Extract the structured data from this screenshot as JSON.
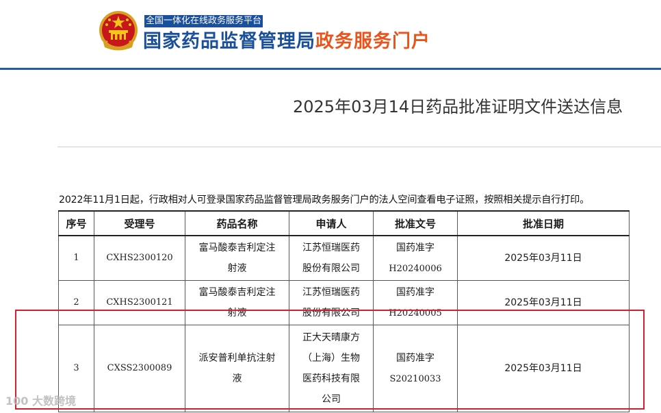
{
  "header": {
    "platform_tag": "全国一体化在线政务服务平台",
    "title_main": "国家药品监督管理局",
    "title_accent": "政务服务门户"
  },
  "page_title": "2025年03月14日药品批准证明文件送达信息",
  "notice": "2022年11月1日起，行政相对人可登录国家药品监督管理局政务服务门户的法人空间查看电子证照，按照相关提示自行打印。",
  "table": {
    "headers": [
      "序号",
      "受理号",
      "药品名称",
      "申请人",
      "批准文号",
      "批准日期"
    ],
    "rows": [
      {
        "no": "1",
        "acceptance_no": "CXHS2300120",
        "drug_name": [
          "富马酸泰吉利定注",
          "射液"
        ],
        "applicant": [
          "江苏恒瑞医药",
          "股份有限公司"
        ],
        "approval_no": [
          "国药准字",
          "H20240006"
        ],
        "approval_date": "2025年03月11日"
      },
      {
        "no": "2",
        "acceptance_no": "CXHS2300121",
        "drug_name": [
          "富马酸泰吉利定注",
          "射液"
        ],
        "applicant": [
          "江苏恒瑞医药",
          "股份有限公司"
        ],
        "approval_no": [
          "国药准字",
          "H20240005"
        ],
        "approval_date": "2025年03月11日"
      },
      {
        "no": "3",
        "acceptance_no": "CXSS2300089",
        "drug_name": [
          "派安普利单抗注射",
          "液"
        ],
        "applicant": [
          "正大天晴康方",
          "（上海）生物",
          "医药科技有限",
          "公司"
        ],
        "approval_no": [
          "国药准字",
          "S20210033"
        ],
        "approval_date": "2025年03月11日"
      }
    ]
  },
  "watermark": "100 大数跨境",
  "colors": {
    "brand_blue": "#1a4f9c",
    "accent_orange": "#e8541c",
    "highlight_red": "#d21e2d"
  }
}
